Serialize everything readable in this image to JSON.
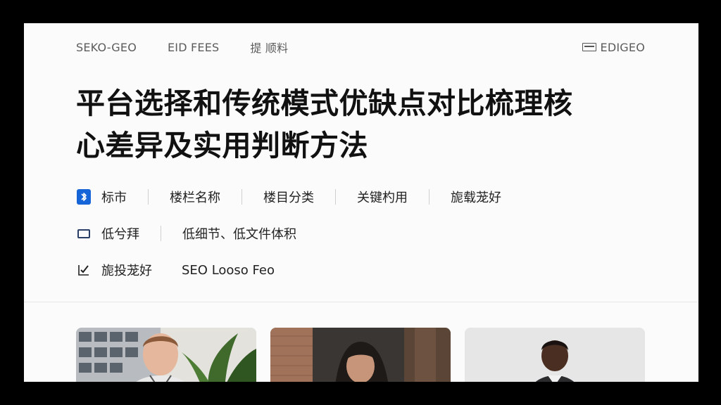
{
  "nav": {
    "links": [
      "SEKO-GEO",
      "EID FEES",
      "提 顺料"
    ],
    "brand": "EDIGEO",
    "brand_icon": "window-icon"
  },
  "article": {
    "title_line1": "平台选择和传统模式优缺点对比梳理核",
    "title_line2": "心差异及实用判断方法"
  },
  "meta": {
    "row1": {
      "icon": "bluetooth-badge-icon",
      "items": [
        "标市",
        "楼栏名称",
        "楼目分类",
        "关键杓用",
        "旎载茏好"
      ]
    },
    "row2": {
      "icon": "rectangle-icon",
      "items": [
        "低兮拜",
        "低细节、低文件体积"
      ]
    },
    "row3": {
      "icon": "checkmark-icon",
      "items": [
        "旎投茏好",
        "SEO Looso Feo"
      ]
    }
  },
  "thumbnails": [
    {
      "subject": "man-portrait",
      "bg": "office-building-with-plant"
    },
    {
      "subject": "woman-portrait",
      "bg": "brick-wall-interior"
    },
    {
      "subject": "man-portrait",
      "bg": "light-grey-studio"
    }
  ],
  "colors": {
    "accent": "#1565d8",
    "title": "#111111",
    "nav_text": "#5c5c5c",
    "card_bg": "#fbfbfb"
  }
}
